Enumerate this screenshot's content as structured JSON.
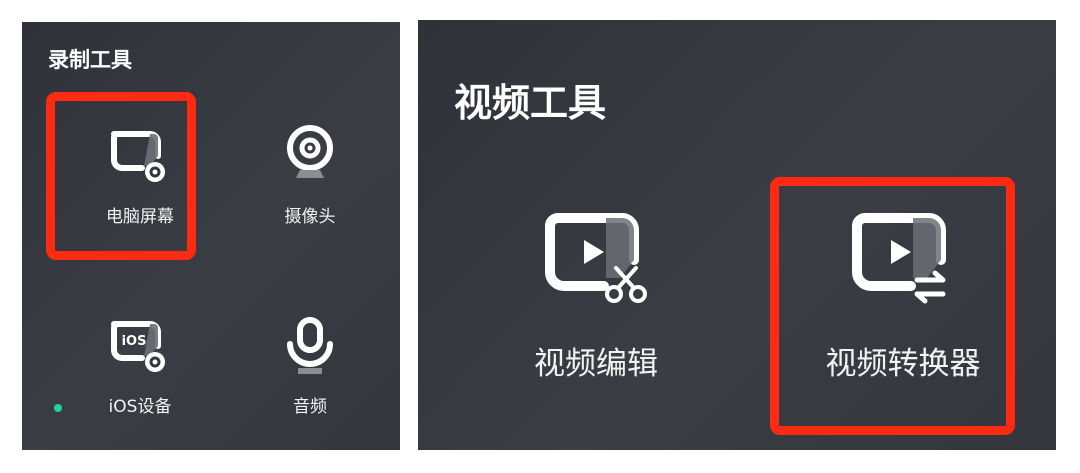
{
  "recording_tools": {
    "title": "录制工具",
    "items": [
      {
        "label": "电脑屏幕",
        "icon": "screen-record-icon"
      },
      {
        "label": "摄像头",
        "icon": "webcam-icon"
      },
      {
        "label": "iOS设备",
        "icon": "ios-device-icon",
        "badge_text": "iOS"
      },
      {
        "label": "音频",
        "icon": "microphone-icon"
      }
    ]
  },
  "video_tools": {
    "title": "视频工具",
    "items": [
      {
        "label": "视频编辑",
        "icon": "video-edit-icon"
      },
      {
        "label": "视频转换器",
        "icon": "video-convert-icon"
      }
    ]
  },
  "colors": {
    "panel_bg": "#34373d",
    "highlight": "#ff2a12",
    "status_dot": "#1ed49a",
    "text": "#ffffff"
  }
}
